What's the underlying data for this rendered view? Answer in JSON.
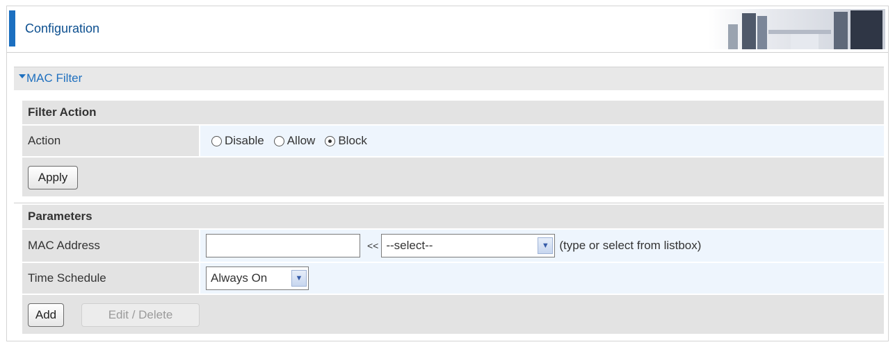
{
  "header": {
    "title": "Configuration"
  },
  "section": {
    "title": "MAC Filter"
  },
  "filter_action": {
    "heading": "Filter Action",
    "action_label": "Action",
    "options": [
      "Disable",
      "Allow",
      "Block"
    ],
    "selected": "Block",
    "apply_label": "Apply"
  },
  "parameters": {
    "heading": "Parameters",
    "mac_label": "MAC Address",
    "mac_value": "",
    "arrow_text": "<<",
    "mac_select_value": "--select--",
    "mac_hint": "(type or select from listbox)",
    "schedule_label": "Time Schedule",
    "schedule_value": "Always On",
    "add_label": "Add",
    "edit_label": "Edit / Delete"
  },
  "colors": {
    "accent": "#1b6fc0",
    "label_bg": "#e3e3e3",
    "value_bg": "#eef5fd"
  },
  "icons": {
    "section_toggle": "triangle-down-icon",
    "dropdown": "chevron-down-icon"
  }
}
